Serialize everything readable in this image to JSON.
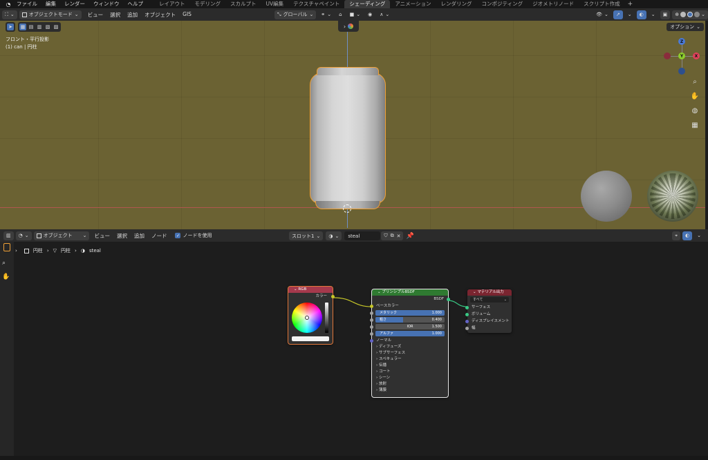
{
  "top_menu": {
    "items": [
      "ファイル",
      "編集",
      "レンダー",
      "ウィンドウ",
      "ヘルプ"
    ],
    "workspaces": [
      "レイアウト",
      "モデリング",
      "スカルプト",
      "UV編集",
      "テクスチャペイント",
      "シェーディング",
      "アニメーション",
      "レンダリング",
      "コンポジティング",
      "ジオメトリノード",
      "スクリプト作成"
    ],
    "active_workspace": "シェーディング",
    "add_symbol": "+"
  },
  "viewport_header": {
    "mode": "オブジェクトモード",
    "menus": [
      "ビュー",
      "選択",
      "追加",
      "オブジェクト",
      "GIS"
    ],
    "orientation": "グローバル"
  },
  "viewport": {
    "view_name": "フロント・平行投影",
    "object_info": "(1) can | 円柱",
    "options_label": "オプション",
    "center_tab_symbol": "›",
    "gizmo": {
      "z": "Z",
      "y": "Y",
      "x": "X"
    },
    "background_color": "#6b6233",
    "selection_color": "#f0a036"
  },
  "node_header": {
    "editor_type": "オブジェクト",
    "menus": [
      "ビュー",
      "選択",
      "追加",
      "ノード"
    ],
    "use_nodes_label": "ノードを使用",
    "use_nodes_checked": true,
    "slot": "スロット1",
    "material_name": "steal"
  },
  "breadcrumb": {
    "object": "円柱",
    "mesh": "円柱",
    "material": "steal"
  },
  "nodes": {
    "rgb": {
      "title": "RGB",
      "output_label": "カラー",
      "header_color": "#a5394c"
    },
    "bsdf": {
      "title": "プリンシプルBSDF",
      "output_label": "BSDF",
      "header_color": "#2f7a31",
      "base_color_label": "ベースカラー",
      "metallic": {
        "label": "メタリック",
        "value": "1.000",
        "fraction": 1.0
      },
      "roughness": {
        "label": "粗さ",
        "value": "0.400",
        "fraction": 0.4
      },
      "ior": {
        "label": "IOR",
        "value": "1.500"
      },
      "alpha": {
        "label": "アルファ",
        "value": "1.000",
        "fraction": 1.0
      },
      "normal_label": "ノーマル",
      "panels": [
        "ディフューズ",
        "サブサーフェス",
        "スペキュラー",
        "伝播",
        "コート",
        "シーン",
        "放射",
        "薄膜"
      ]
    },
    "output": {
      "title": "マテリアル出力",
      "target": "すべて",
      "header_color": "#7a2530",
      "inputs": [
        "サーフェス",
        "ボリューム",
        "ディスプレイスメント",
        "幅"
      ]
    }
  }
}
